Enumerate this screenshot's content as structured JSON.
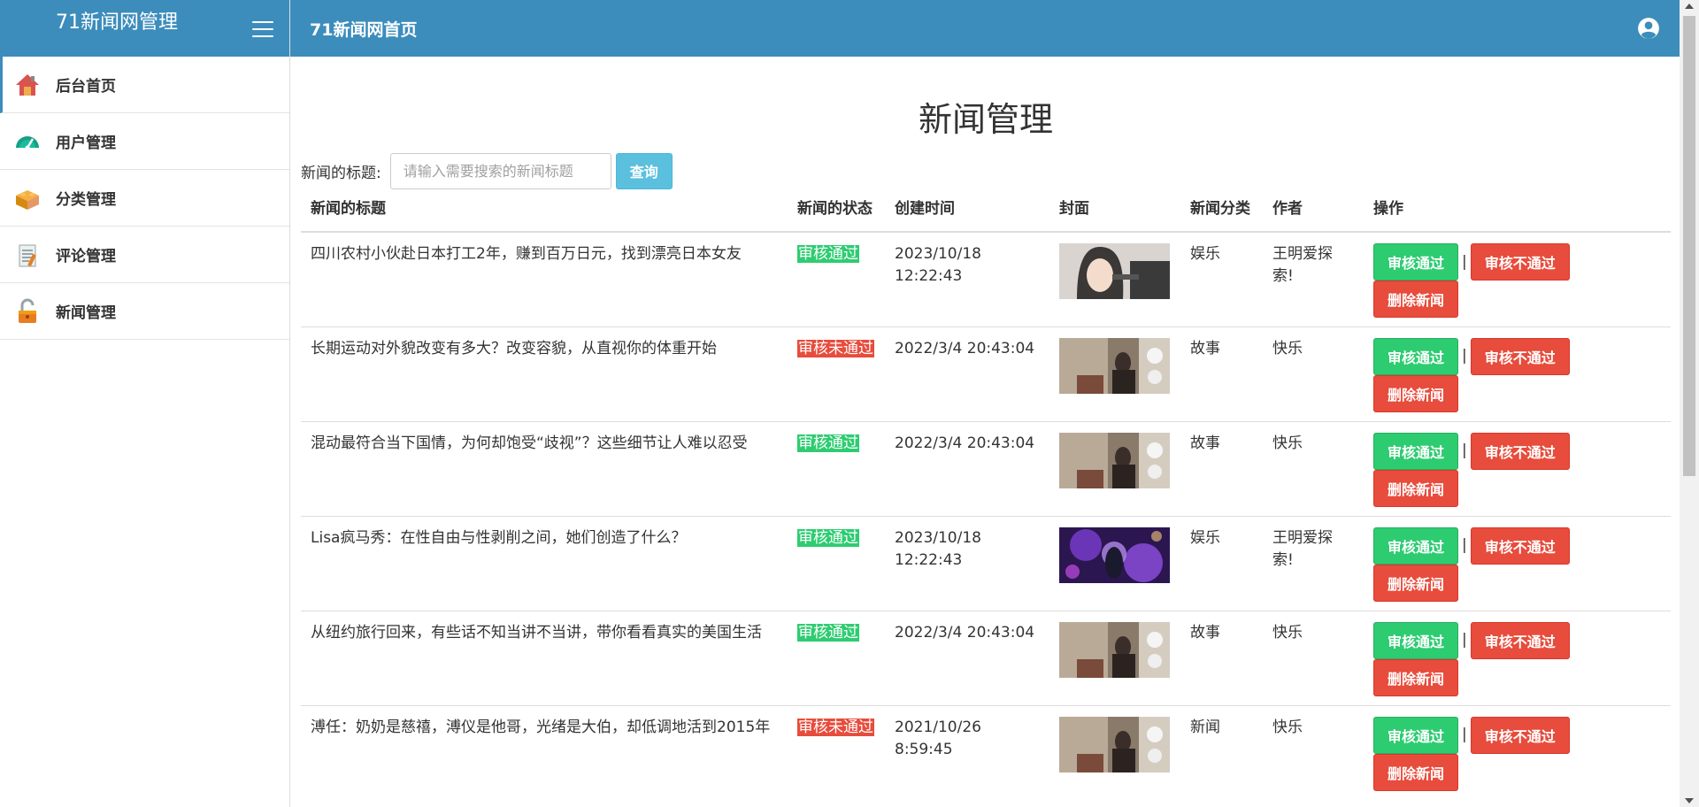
{
  "sidebar": {
    "brand": "71新闻网管理",
    "items": [
      {
        "label": "后台首页",
        "icon": "home-icon",
        "active": true
      },
      {
        "label": "用户管理",
        "icon": "gauge-icon",
        "active": false
      },
      {
        "label": "分类管理",
        "icon": "block-icon",
        "active": false
      },
      {
        "label": "评论管理",
        "icon": "notepad-icon",
        "active": false
      },
      {
        "label": "新闻管理",
        "icon": "unlock-icon",
        "active": false
      }
    ]
  },
  "header": {
    "title": "71新闻网首页",
    "user_icon": "user-circle-icon"
  },
  "main": {
    "title": "新闻管理",
    "search": {
      "label": "新闻的标题:",
      "placeholder": "请输入需要搜索的新闻标题",
      "button": "查询"
    },
    "table": {
      "headers": [
        "新闻的标题",
        "新闻的状态",
        "创建时间",
        "封面",
        "新闻分类",
        "作者",
        "操作"
      ],
      "action_labels": {
        "approve": "审核通过",
        "reject": "审核不通过",
        "delete": "删除新闻",
        "separator": "|"
      },
      "rows": [
        {
          "title": "四川农村小伙赴日本打工2年，赚到百万日元，找到漂亮日本女友",
          "status": "审核通过",
          "status_ok": true,
          "time": "2023/10/18 12:22:43",
          "cover": "portrait",
          "category": "娱乐",
          "author": "王明爱探索!"
        },
        {
          "title": "长期运动对外貌改变有多大？改变容貌，从直视你的体重开始",
          "status": "审核未通过",
          "status_ok": false,
          "time": "2022/3/4 20:43:04",
          "cover": "room",
          "category": "故事",
          "author": "快乐"
        },
        {
          "title": "混动最符合当下国情，为何却饱受“歧视”？这些细节让人难以忍受",
          "status": "审核通过",
          "status_ok": true,
          "time": "2022/3/4 20:43:04",
          "cover": "room",
          "category": "故事",
          "author": "快乐"
        },
        {
          "title": "Lisa疯马秀：在性自由与性剥削之间，她们创造了什么？",
          "status": "审核通过",
          "status_ok": true,
          "time": "2023/10/18 12:22:43",
          "cover": "purple",
          "category": "娱乐",
          "author": "王明爱探索!"
        },
        {
          "title": "从纽约旅行回来，有些话不知当讲不当讲，带你看看真实的美国生活",
          "status": "审核通过",
          "status_ok": true,
          "time": "2022/3/4 20:43:04",
          "cover": "room",
          "category": "故事",
          "author": "快乐"
        },
        {
          "title": "溥任：奶奶是慈禧，溥仪是他哥，光绪是大伯，却低调地活到2015年",
          "status": "审核未通过",
          "status_ok": false,
          "time": "2021/10/26 8:59:45",
          "cover": "room",
          "category": "新闻",
          "author": "快乐"
        }
      ]
    }
  },
  "colors": {
    "primary": "#3c8dbc",
    "success": "#2ecc71",
    "danger": "#e74c3c",
    "info": "#5bc0de"
  }
}
